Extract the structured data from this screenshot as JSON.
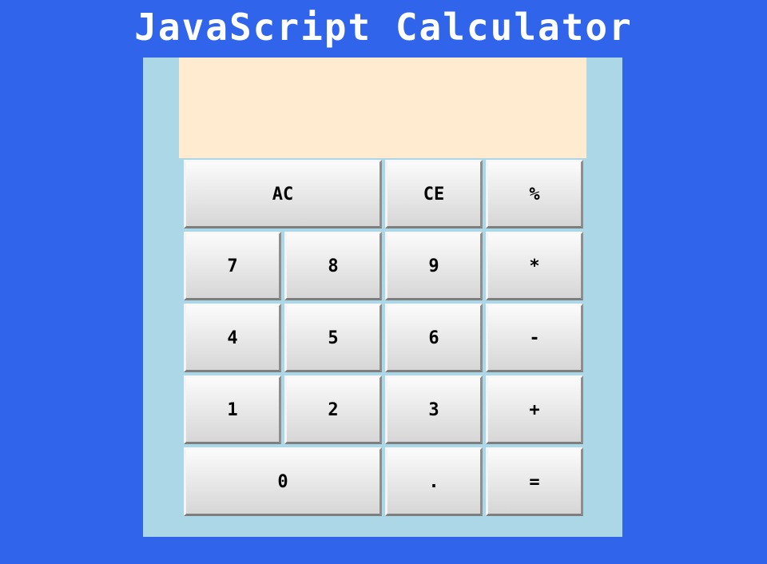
{
  "page": {
    "title": "JavaScript Calculator"
  },
  "display": {
    "value": ""
  },
  "keys": {
    "ac": "AC",
    "ce": "CE",
    "percent": "%",
    "seven": "7",
    "eight": "8",
    "nine": "9",
    "multiply": "*",
    "four": "4",
    "five": "5",
    "six": "6",
    "subtract": "-",
    "one": "1",
    "two": "2",
    "three": "3",
    "add": "+",
    "zero": "0",
    "decimal": ".",
    "equals": "="
  },
  "colors": {
    "page_background": "#3064ea",
    "calculator_body": "#acd7e6",
    "display_background": "#ffecd0",
    "title_text": "#ffffff",
    "key_text": "#000000"
  }
}
